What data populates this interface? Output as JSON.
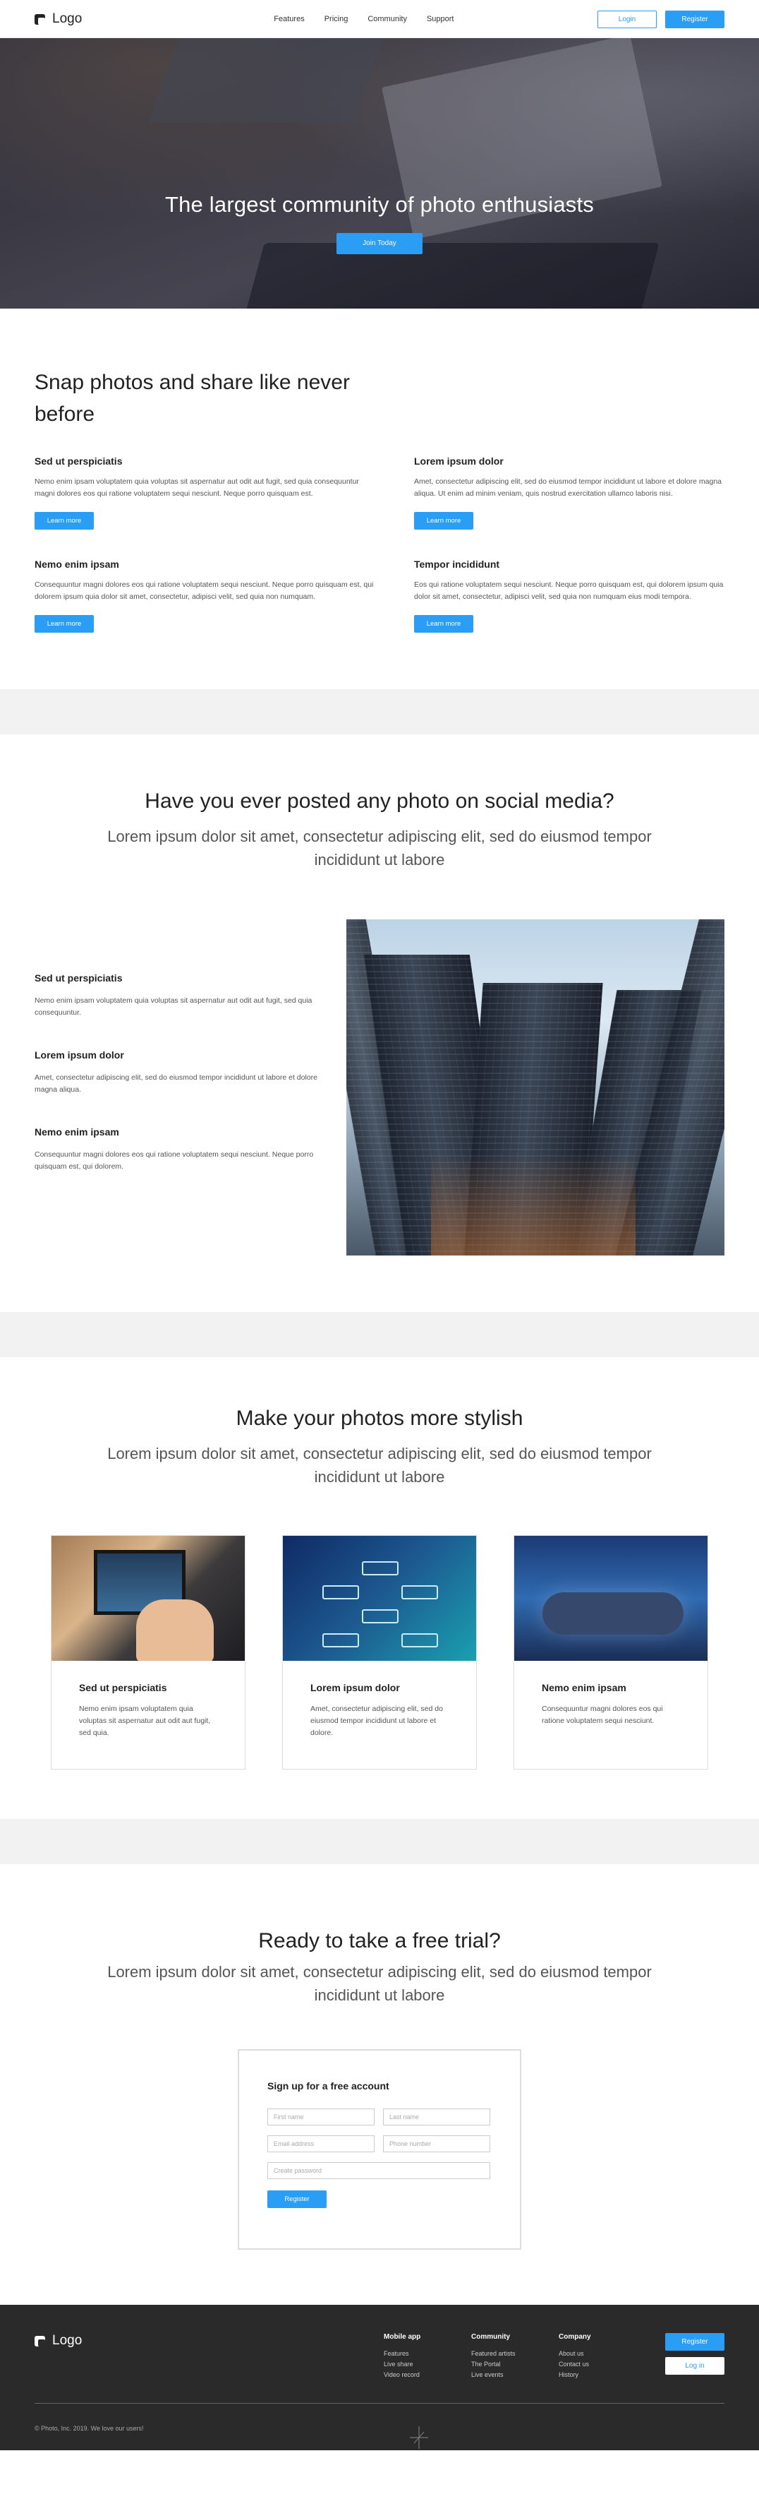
{
  "header": {
    "logo_text": "Logo",
    "nav": [
      "Features",
      "Pricing",
      "Community",
      "Support"
    ],
    "login_label": "Login",
    "register_label": "Register"
  },
  "hero": {
    "title": "The largest community of photo enthusiasts",
    "button_label": "Join Today"
  },
  "features": {
    "title": "Snap photos and share like never before",
    "items": [
      {
        "title": "Sed ut perspiciatis",
        "text": "Nemo enim ipsam voluptatem quia voluptas sit aspernatur aut odit aut fugit, sed quia consequuntur magni dolores eos qui ratione voluptatem sequi nesciunt. Neque porro quisquam est.",
        "button": "Learn more"
      },
      {
        "title": "Lorem ipsum dolor",
        "text": "Amet, consectetur adipiscing elit, sed do eiusmod tempor incididunt ut labore et dolore magna aliqua. Ut enim ad minim veniam, quis nostrud exercitation ullamco laboris nisi.",
        "button": "Learn more"
      },
      {
        "title": "Nemo enim ipsam",
        "text": "Consequuntur magni dolores eos qui ratione voluptatem sequi nesciunt. Neque porro quisquam est, qui dolorem ipsum quia dolor sit amet, consectetur, adipisci velit, sed quia non numquam.",
        "button": "Learn more"
      },
      {
        "title": "Tempor incididunt",
        "text": "Eos qui ratione voluptatem sequi nesciunt. Neque porro quisquam est, qui dolorem ipsum quia dolor sit amet, consectetur, adipisci velit, sed quia non numquam eius modi tempora.",
        "button": "Learn more"
      }
    ]
  },
  "social": {
    "title": "Have you ever posted any photo on social media?",
    "subtitle": "Lorem ipsum dolor sit amet, consectetur adipiscing elit, sed do eiusmod tempor incididunt ut labore",
    "items": [
      {
        "title": "Sed ut perspiciatis",
        "text": "Nemo enim ipsam voluptatem quia voluptas sit aspernatur aut odit aut fugit, sed quia consequuntur."
      },
      {
        "title": "Lorem ipsum dolor",
        "text": "Amet, consectetur adipiscing elit, sed do eiusmod tempor incididunt ut labore et dolore magna aliqua."
      },
      {
        "title": "Nemo enim ipsam",
        "text": "Consequuntur magni dolores eos qui ratione voluptatem sequi nesciunt. Neque porro quisquam est, qui dolorem."
      }
    ]
  },
  "stylish": {
    "title": "Make your photos more stylish",
    "subtitle": "Lorem ipsum dolor sit amet, consectetur adipiscing elit, sed do eiusmod tempor incididunt ut labore",
    "cards": [
      {
        "title": "Sed ut perspiciatis",
        "text": "Nemo enim ipsam voluptatem quia voluptas sit aspernatur aut odit aut fugit, sed quia."
      },
      {
        "title": "Lorem ipsum dolor",
        "text": "Amet, consectetur adipiscing elit, sed do eiusmod tempor incididunt ut labore et dolore."
      },
      {
        "title": "Nemo enim ipsam",
        "text": "Consequuntur magni dolores eos qui ratione voluptatem sequi nesciunt."
      }
    ]
  },
  "trial": {
    "title": "Ready to take a free trial?",
    "subtitle": "Lorem ipsum dolor sit amet, consectetur adipiscing elit, sed do eiusmod tempor incididunt ut labore",
    "form": {
      "title": "Sign up for a free account",
      "first_name": "First name",
      "last_name": "Last name",
      "email": "Email address",
      "phone": "Phone number",
      "password": "Create password",
      "button": "Register"
    }
  },
  "footer": {
    "logo_text": "Logo",
    "columns": [
      {
        "title": "Mobile app",
        "links": [
          "Features",
          "Live share",
          "Video record"
        ]
      },
      {
        "title": "Community",
        "links": [
          "Featured artists",
          "The Portal",
          "Live events"
        ]
      },
      {
        "title": "Company",
        "links": [
          "About us",
          "Contact us",
          "History"
        ]
      }
    ],
    "register_label": "Register",
    "login_label": "Log in",
    "copyright": "© Photo, Inc. 2019. We love our users!"
  },
  "colors": {
    "accent": "#2a9df4",
    "footer_bg": "#2a2a2a",
    "band": "#f2f2f2"
  }
}
